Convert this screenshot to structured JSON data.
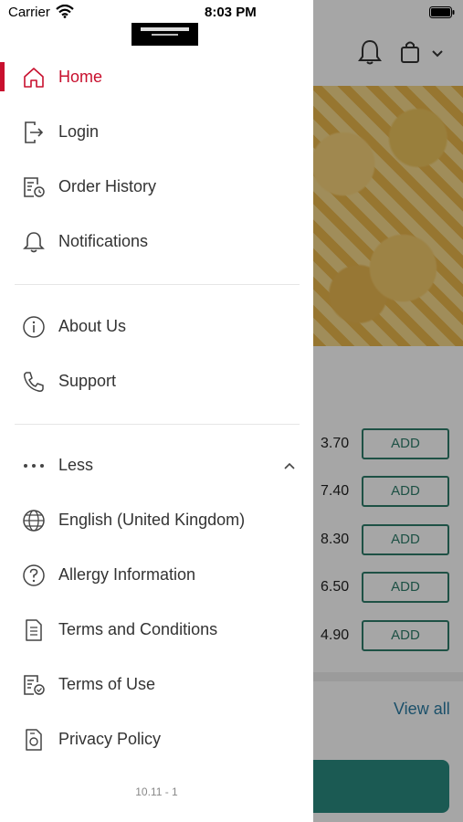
{
  "status_bar": {
    "carrier": "Carrier",
    "time": "8:03 PM"
  },
  "drawer": {
    "logo_text": "",
    "menu_group_1": [
      {
        "label": "Home",
        "icon": "home-icon",
        "active": true
      },
      {
        "label": "Login",
        "icon": "login-icon"
      },
      {
        "label": "Order History",
        "icon": "order-history-icon"
      },
      {
        "label": "Notifications",
        "icon": "bell-icon"
      }
    ],
    "menu_group_2": [
      {
        "label": "About Us",
        "icon": "info-icon"
      },
      {
        "label": "Support",
        "icon": "phone-icon"
      }
    ],
    "less_label": "Less",
    "menu_group_3": [
      {
        "label": "English (United Kingdom)",
        "icon": "globe-icon"
      },
      {
        "label": "Allergy Information",
        "icon": "question-icon"
      },
      {
        "label": "Terms and Conditions",
        "icon": "document-icon"
      },
      {
        "label": "Terms of Use",
        "icon": "document-check-icon"
      },
      {
        "label": "Privacy Policy",
        "icon": "privacy-icon"
      }
    ],
    "version": "10.11 - 1"
  },
  "background": {
    "products": [
      {
        "price": "3.70",
        "add": "ADD"
      },
      {
        "price": "7.40",
        "add": "ADD"
      },
      {
        "price": "8.30",
        "add": "ADD"
      },
      {
        "price": "6.50",
        "add": "ADD"
      },
      {
        "price": "4.90",
        "add": "ADD"
      }
    ],
    "view_all": "View all"
  },
  "colors": {
    "accent": "#c8102e",
    "add_button": "#2e7d6b",
    "link": "#2a7ca3",
    "cta": "#2a8a80"
  }
}
